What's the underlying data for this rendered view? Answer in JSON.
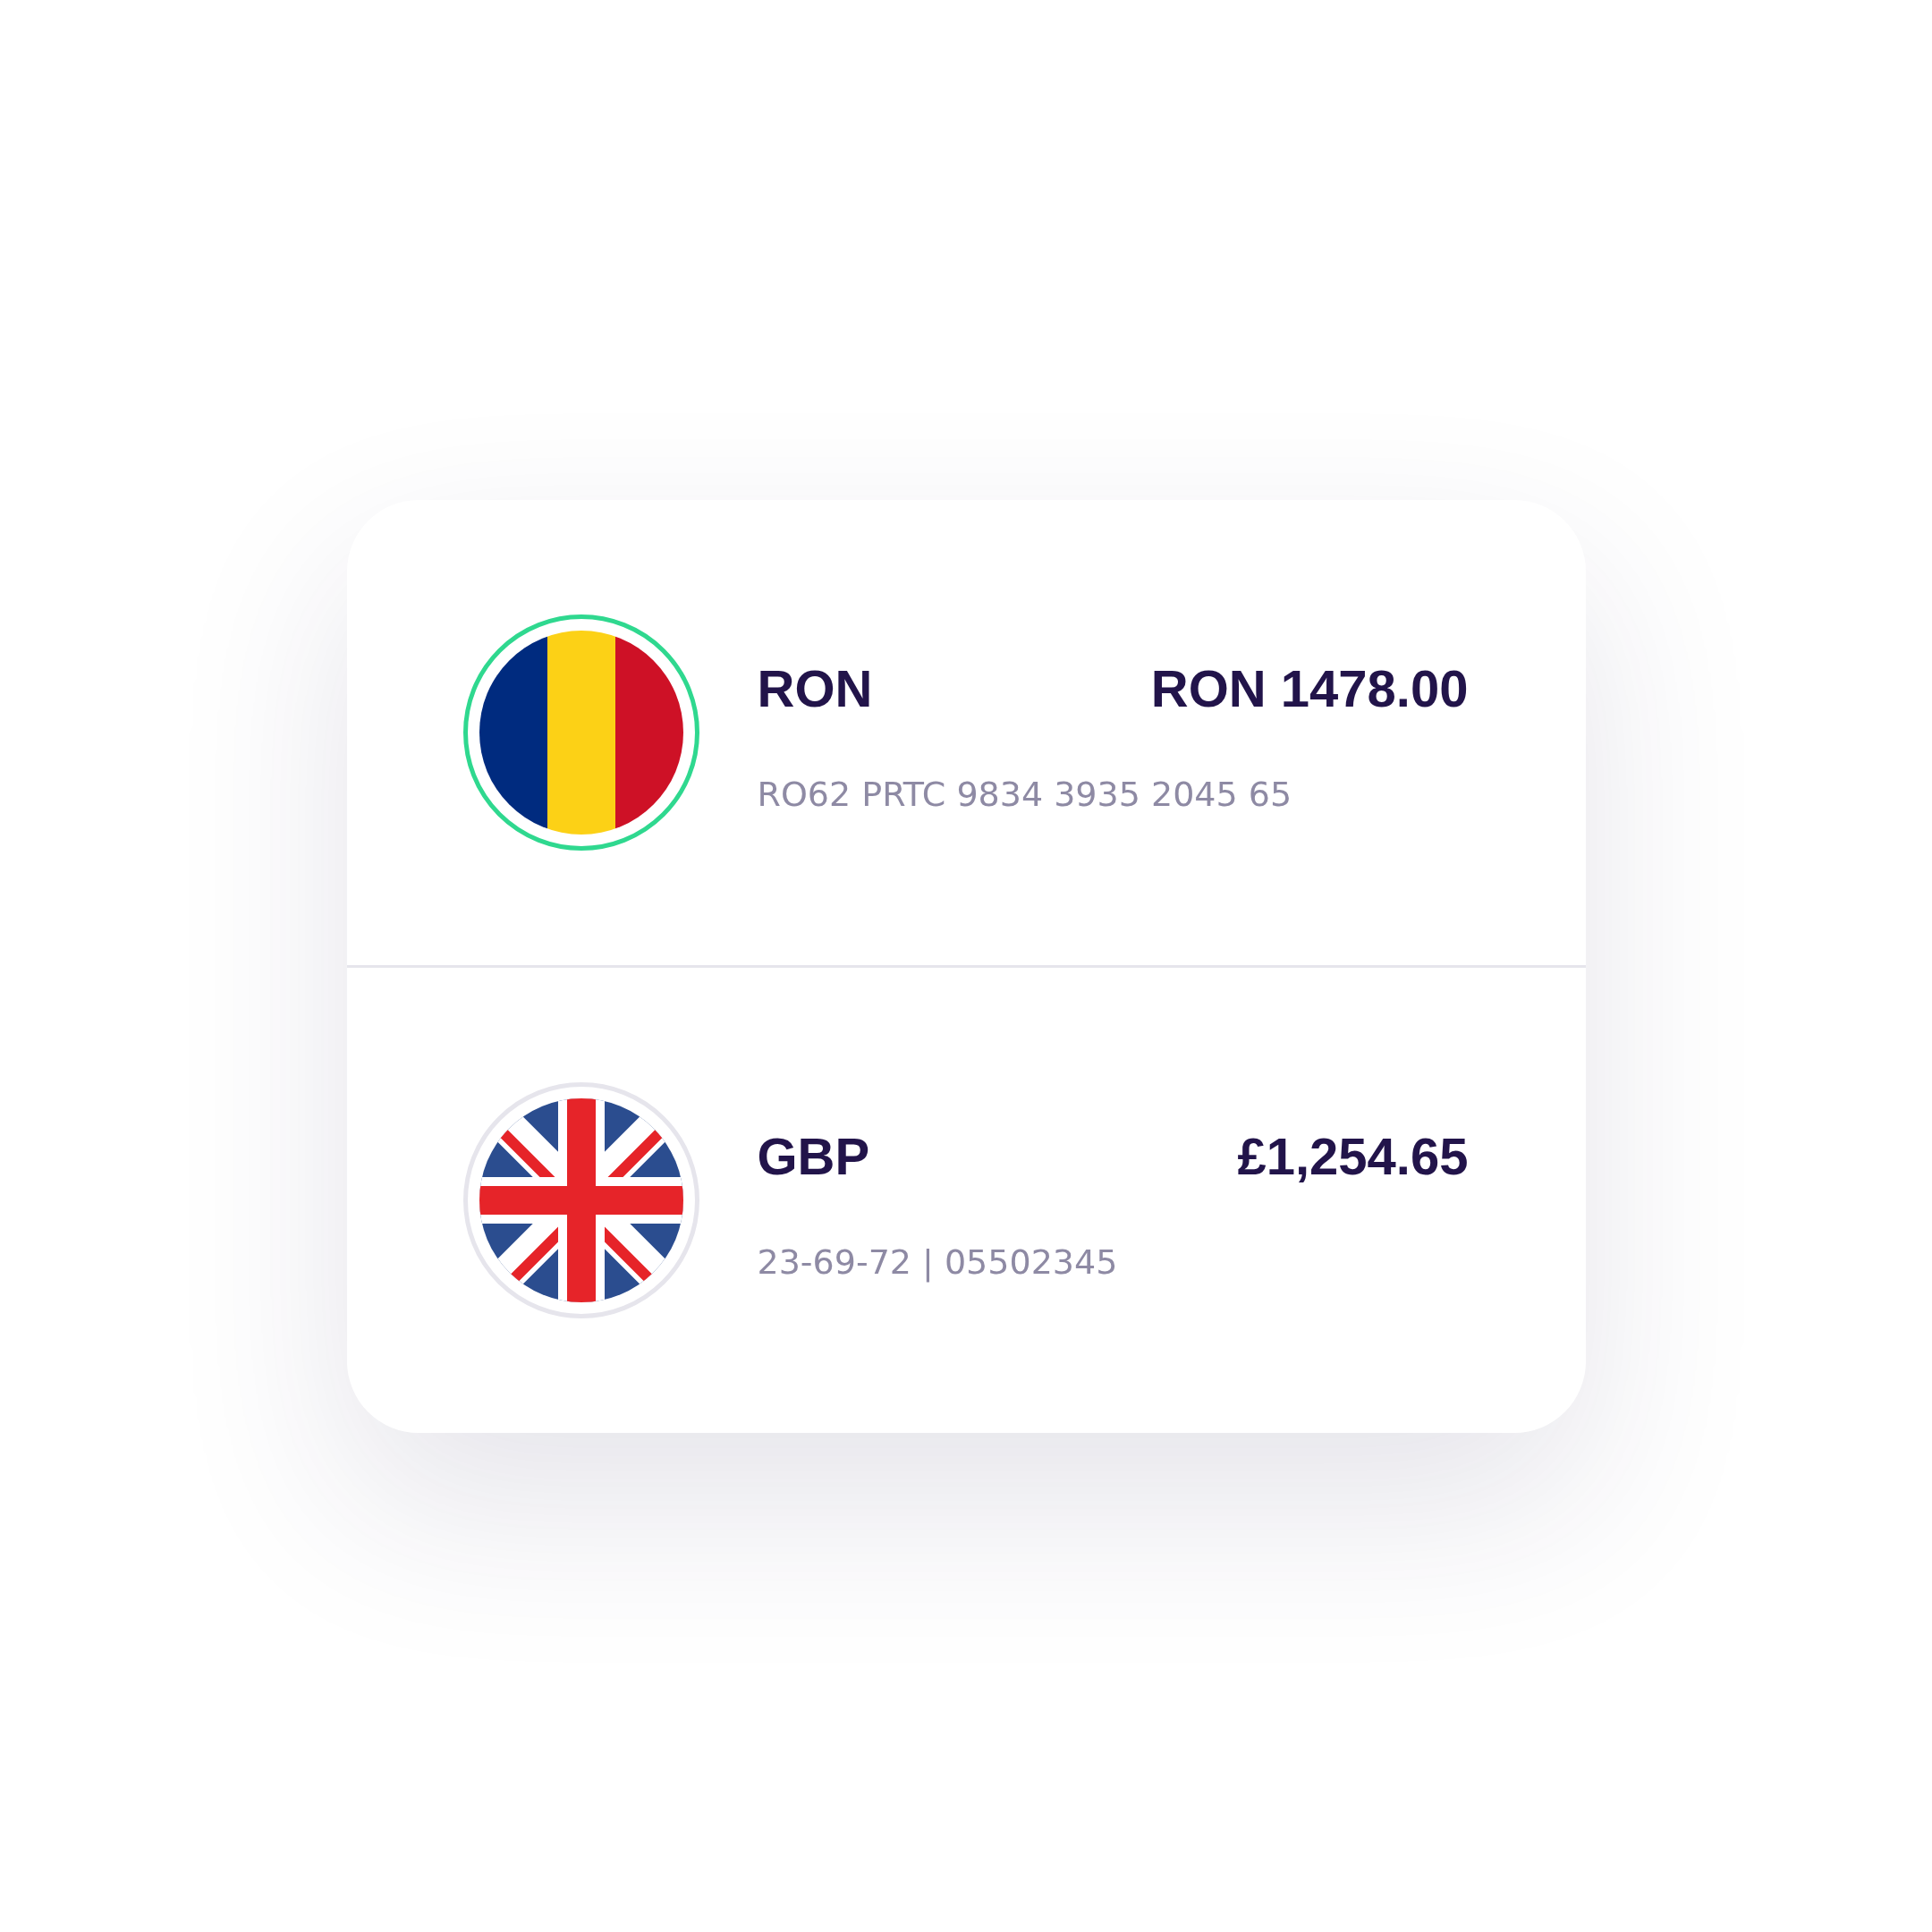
{
  "accounts": [
    {
      "flag": {
        "kind": "romania"
      },
      "selected": true,
      "currency": "RON",
      "balance": "RON 1478.00",
      "account_number": "RO62 PRTC 9834 3935 2045 65"
    },
    {
      "flag": {
        "kind": "united-kingdom"
      },
      "selected": false,
      "currency": "GBP",
      "balance": "£1,254.65",
      "account_number": "23-69-72 | 05502345"
    }
  ]
}
